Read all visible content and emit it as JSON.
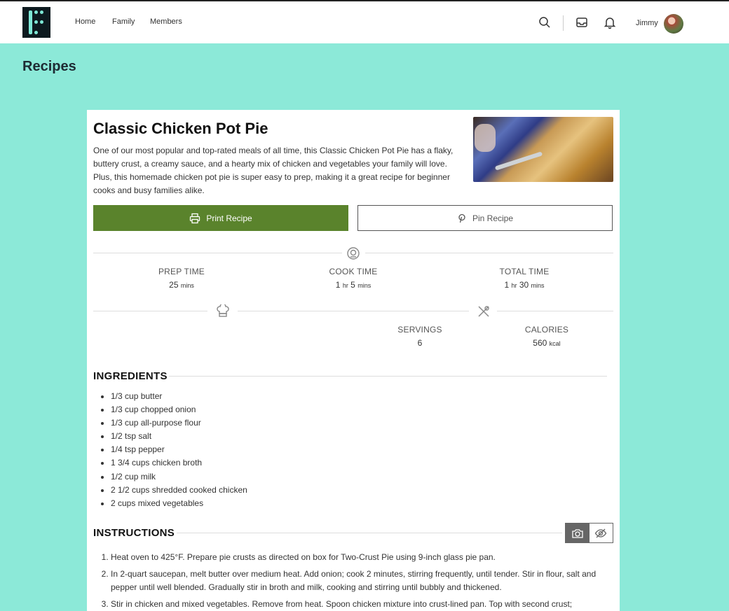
{
  "nav": {
    "links": [
      "Home",
      "Family",
      "Members"
    ],
    "user_name": "Jimmy"
  },
  "page": {
    "title": "Recipes"
  },
  "recipe": {
    "title": "Classic Chicken Pot Pie",
    "description": "One of our most popular and top-rated meals of all time, this Classic Chicken Pot Pie has a flaky, buttery crust, a creamy sauce, and a hearty mix of chicken and vegetables your family will love. Plus, this homemade chicken pot pie is super easy to prep, making it a great recipe for beginner cooks and busy families alike.",
    "print_label": "Print Recipe",
    "pin_label": "Pin Recipe",
    "accent_color": "#5a832c",
    "times": {
      "prep_label": "PREP TIME",
      "prep_value": "25",
      "prep_unit": "mins",
      "cook_label": "COOK TIME",
      "cook_hr": "1",
      "cook_hr_unit": "hr",
      "cook_min": "5",
      "cook_min_unit": "mins",
      "total_label": "TOTAL TIME",
      "total_hr": "1",
      "total_hr_unit": "hr",
      "total_min": "30",
      "total_min_unit": "mins"
    },
    "servings_label": "SERVINGS",
    "servings_value": "6",
    "calories_label": "CALORIES",
    "calories_value": "560",
    "calories_unit": "kcal",
    "ingredients_title": "INGREDIENTS",
    "ingredients": [
      "1/3 cup butter",
      "1/3 cup chopped onion",
      "1/3 cup all-purpose flour",
      "1/2 tsp salt",
      "1/4 tsp pepper",
      "1 3/4 cups chicken broth",
      "1/2 cup milk",
      "2 1/2 cups shredded cooked chicken",
      "2 cups mixed vegetables"
    ],
    "instructions_title": "INSTRUCTIONS",
    "instructions": [
      "Heat oven to 425°F. Prepare pie crusts as directed on box for Two-Crust Pie using 9-inch glass pie pan.",
      "In 2-quart saucepan, melt butter over medium heat. Add onion; cook 2 minutes, stirring frequently, until tender. Stir in flour, salt and pepper until well blended. Gradually stir in broth and milk, cooking and stirring until bubbly and thickened.",
      "Stir in chicken and mixed vegetables. Remove from heat. Spoon chicken mixture into crust-lined pan. Top with second crust;"
    ]
  }
}
